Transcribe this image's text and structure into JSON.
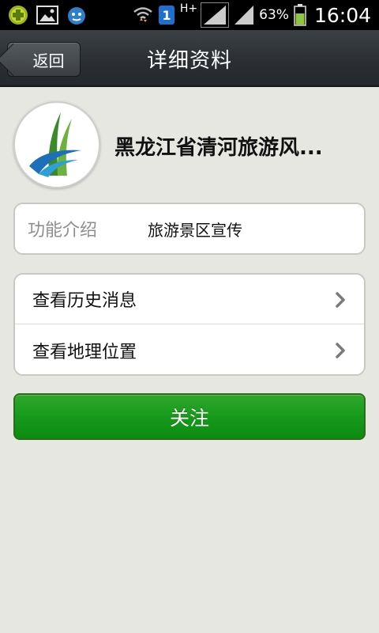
{
  "status_bar": {
    "time": "16:04",
    "battery_percent": "63%",
    "network_type": "H+",
    "notification_badge": "1",
    "icons": [
      "app-notification-icon",
      "gallery-icon",
      "qq-icon",
      "wifi-icon",
      "sim-badge-icon",
      "signal-icon",
      "signal-icon-2",
      "battery-icon"
    ]
  },
  "header": {
    "back_label": "返回",
    "title": "详细资料"
  },
  "profile": {
    "name": "黑龙江省清河旅游风...",
    "avatar": "logo-avatar"
  },
  "intro": {
    "label": "功能介绍",
    "value": "旅游景区宣传"
  },
  "links": [
    {
      "label": "查看历史消息",
      "icon": "chevron-right-icon"
    },
    {
      "label": "查看地理位置",
      "icon": "chevron-right-icon"
    }
  ],
  "follow_button": {
    "label": "关注"
  },
  "colors": {
    "accent_green": "#179a1b",
    "title_bar": "#2a2e32",
    "page_bg": "#e7e7e2",
    "battery_green": "#8dc63f"
  }
}
